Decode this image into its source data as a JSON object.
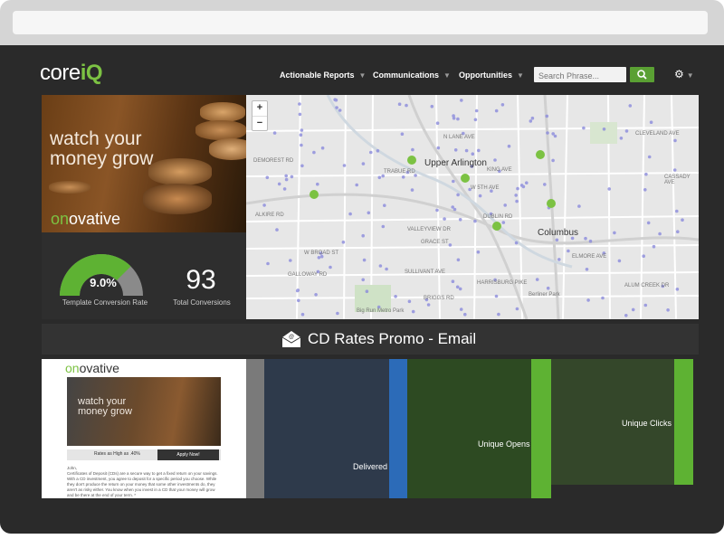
{
  "nav": {
    "brand": {
      "text": "core",
      "accent": "iQ"
    },
    "items": [
      {
        "label": "Actionable Reports"
      },
      {
        "label": "Communications"
      },
      {
        "label": "Opportunities"
      }
    ],
    "search": {
      "placeholder": "Search Phrase..."
    }
  },
  "promo": {
    "headline_line1": "watch your",
    "headline_line2": "money grow",
    "brand_accent": "on",
    "brand_rest": "ovative"
  },
  "stats": {
    "conversion_rate": "9.0%",
    "conversion_rate_fraction": 0.09,
    "conversion_rate_label": "Template Conversion Rate",
    "total_conversions": "93",
    "total_conversions_label": "Total Conversions"
  },
  "map": {
    "zoom_in": "+",
    "zoom_out": "−",
    "labels": [
      {
        "text": "Upper Arlington"
      },
      {
        "text": "Columbus"
      },
      {
        "text": "Big Run Metro Park"
      },
      {
        "text": "Berliner Park"
      },
      {
        "text": "W BROAD ST"
      },
      {
        "text": "W 5TH AVE"
      },
      {
        "text": "KING AVE"
      },
      {
        "text": "N LANE AVE"
      },
      {
        "text": "GRACE ST"
      },
      {
        "text": "SULLIVANT AVE"
      },
      {
        "text": "BRIGGS RD"
      },
      {
        "text": "VALLEYVIEW DR"
      },
      {
        "text": "DUBLIN RD"
      },
      {
        "text": "TRABUE RD"
      },
      {
        "text": "CLEVELAND AVE"
      },
      {
        "text": "GALLOWAY RD"
      },
      {
        "text": "DEMOREST RD"
      },
      {
        "text": "HARRISBURG PIKE"
      },
      {
        "text": "ELMORE AVE"
      },
      {
        "text": "ALUM CREEK DR"
      },
      {
        "text": "CASSADY AVE"
      },
      {
        "text": "ALKIRE RD"
      }
    ]
  },
  "email": {
    "title": "CD Rates Promo - Email",
    "preview": {
      "brand_accent": "on",
      "brand_rest": "ovative",
      "banner_line1": "watch your",
      "banner_line2": "money grow",
      "rate_text": "Rates as High as .40%",
      "apply_label": "Apply Now!",
      "greeting": "John,",
      "body_text": "Certificates of Deposit (CDs) are a secure way to get a fixed return on your savings. With a CD investment, you agree to deposit for a specific period you choose. While they don't produce the return on your money that some other investments do, they aren't as risky either. You know when you invest in a CD that your money will grow and be there at the end of your term. *"
    },
    "funnel": [
      {
        "label": "Delivered"
      },
      {
        "label": "Unique Opens"
      },
      {
        "label": "Unique Clicks"
      }
    ]
  },
  "colors": {
    "accent": "#7cc243",
    "delivered_fill": "#2e3a4b",
    "delivered_bar": "#2c6bb8",
    "opens_fill": "#2d4a22",
    "opens_bar": "#5eb233",
    "clicks_fill": "#34472a",
    "clicks_bar": "#5eb233"
  }
}
